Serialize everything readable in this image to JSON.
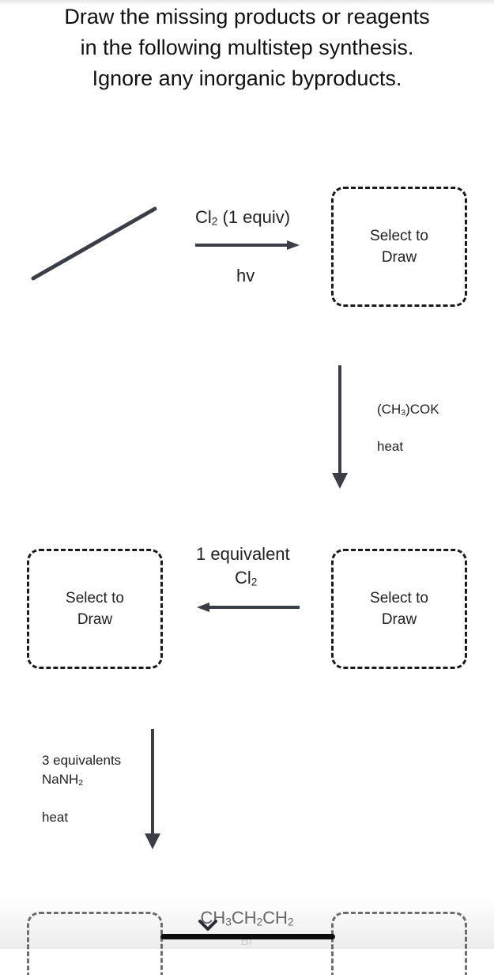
{
  "question": {
    "lines": [
      "Draw the missing products or reagents",
      "in the following multistep synthesis.",
      "Ignore any inorganic byproducts."
    ]
  },
  "starting_material": {
    "structure": "propane (bond-line skeleton)"
  },
  "steps": [
    {
      "direction": "right",
      "reagent_main": "Cl",
      "reagent_main_sub": "2",
      "reagent_main_suffix": " (1 equiv)",
      "condition": "hv"
    },
    {
      "direction": "down",
      "reagent_main": "(CH",
      "reagent_main_sub": "3",
      "reagent_main_suffix": ")COK",
      "condition": "heat"
    },
    {
      "direction": "left",
      "reagent_line1": "1 equivalent",
      "reagent_main": "Cl",
      "reagent_main_sub": "2"
    },
    {
      "direction": "down",
      "reagent_line1": "3 equivalents",
      "reagent_main": "NaNH",
      "reagent_main_sub": "2",
      "condition": "heat"
    }
  ],
  "drop_boxes": [
    {
      "label_line1": "Select to",
      "label_line2": "Draw"
    },
    {
      "label_line1": "Select to",
      "label_line2": "Draw"
    },
    {
      "label_line1": "Select to",
      "label_line2": "Draw"
    }
  ],
  "answer_chip": {
    "part1": "CH",
    "sub1": "3",
    "part2": "CH",
    "sub2": "2",
    "part3": "CH",
    "sub3": "2",
    "ghost_text": "Br"
  },
  "icons": {
    "chevron": "chevron-down-icon"
  },
  "colors": {
    "arrow": "#3a3f47",
    "box_border": "#1a1a1a",
    "text": "#222222"
  }
}
